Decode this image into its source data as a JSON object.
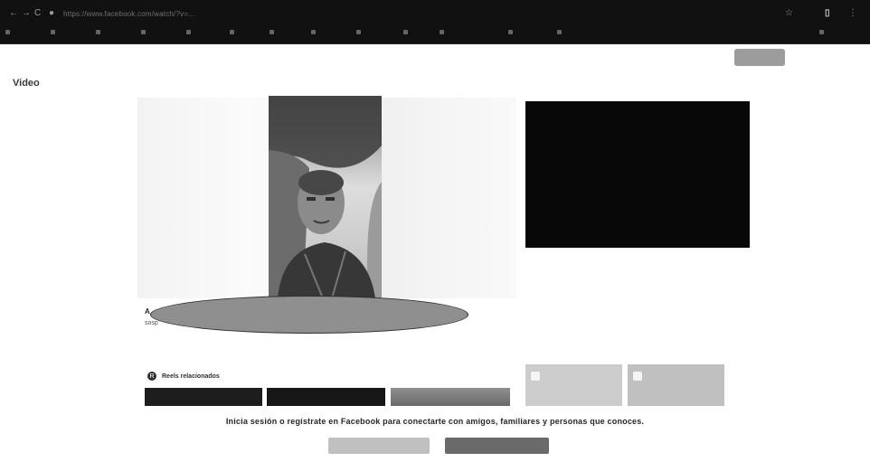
{
  "browser": {
    "nav_back": "←",
    "nav_forward": "→",
    "nav_reload": "C",
    "url": "https://www.facebook.com/watch/?v=...",
    "right_icons": [
      "☆",
      "⋮"
    ],
    "bookmarks": [
      "",
      "",
      "",
      "",
      "",
      "",
      "",
      "",
      "",
      "",
      "",
      "",
      "",
      "",
      ""
    ]
  },
  "header": {
    "logo": "",
    "email_placeholder": "",
    "password_placeholder": "",
    "login_button": ""
  },
  "nav": {
    "title": "Video",
    "tabs": [
      "",
      "",
      "",
      "",
      ""
    ],
    "right_text": ""
  },
  "post": {
    "caption_line1": "A",
    "caption_line2": "sosp",
    "caption_tail": "",
    "tiny_mark": ""
  },
  "right_panel": {
    "meta_left": "",
    "meta_right": "",
    "thumbs": [
      {
        "label": ""
      },
      {
        "label": ""
      }
    ]
  },
  "reels": {
    "title": "Reels relacionados",
    "icon": "R"
  },
  "login_prompt": {
    "text": "Inicia sesión o regístrate en Facebook para conectarte con amigos, familiares y personas que conoces.",
    "login_button": "",
    "create_button": ""
  }
}
